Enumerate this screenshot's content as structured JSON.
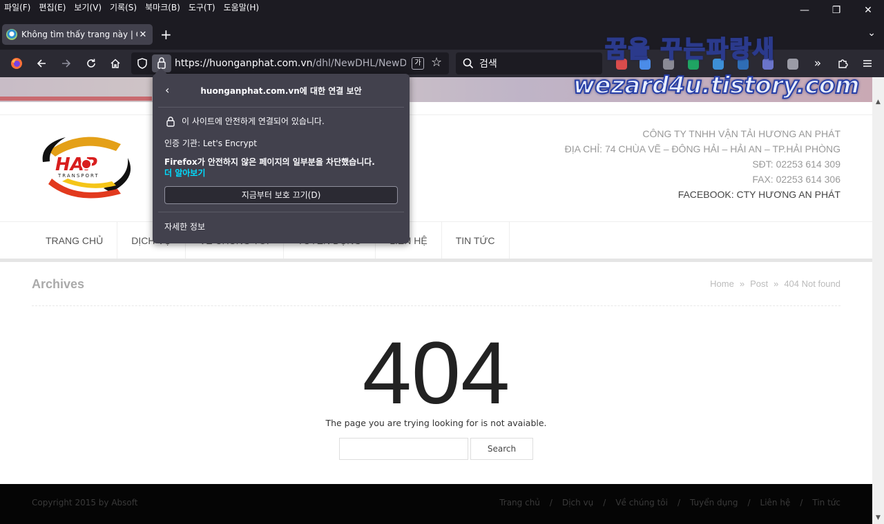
{
  "menubar": {
    "items": [
      "파일(F)",
      "편집(E)",
      "보기(V)",
      "기록(S)",
      "북마크(B)",
      "도구(T)",
      "도움말(H)"
    ]
  },
  "window_controls": {
    "minimize": "—",
    "restore": "❐",
    "close": "✕"
  },
  "tab": {
    "title": "Không tìm thấy trang này | Cô",
    "close": "✕"
  },
  "toolbar": {
    "new_tab": "+",
    "tab_list": "⌄",
    "url_host": "https://huonganphat.com.vn",
    "url_path": "/dhl/NewDHL/NewDHL/",
    "search_placeholder": "검색",
    "translate_glyph": "가",
    "star": "☆"
  },
  "watermark": {
    "line1": "꿈을 꾸는파랑새",
    "line2": "wezard4u.tistory.com"
  },
  "security_popup": {
    "title": "huonganphat.com.vn에 대한 연결 보안",
    "secure_text": "이 사이트에 안전하게 연결되어 있습니다.",
    "issuer": "인증 기관: Let's Encrypt",
    "blocked_text": "Firefox가 안전하지 않은 페이지의 일부분을 차단했습니다.",
    "learn_more": "더 알아보기",
    "disable_button": "지금부터 보호 끄기(D)",
    "more_info": "자세한 정보"
  },
  "site": {
    "company_lines": [
      "CÔNG TY TNHH VẬN TẢI HƯƠNG AN PHÁT",
      "ĐỊA CHỈ: 74 CHÙA VẼ – ĐÔNG HẢI – HẢI AN – TP.HẢI PHÒNG",
      "SĐT: 02253 614 309",
      "FAX: 02253 614 306"
    ],
    "facebook": "FACEBOOK: CTY HƯƠNG AN PHÁT",
    "logo_text": "HAP",
    "logo_sub": "TRANSPORT",
    "nav": [
      "TRANG CHỦ",
      "DỊCH VỤ",
      "VỀ CHÚNG TÔI",
      "TUYỂN DỤNG",
      "LIÊN HỆ",
      "TIN TỨC"
    ],
    "archives_title": "Archives",
    "breadcrumbs": [
      "Home",
      "Post",
      "404 Not found"
    ],
    "breadcrumb_sep": "»",
    "error_code": "404",
    "error_message": "The page you are trying looking for is not avaiable.",
    "search_button": "Search",
    "footer_copy": "Copyright 2015 by Absoft",
    "footer_links": [
      "Trang chủ",
      "Dịch vụ",
      "Về chúng tôi",
      "Tuyển dụng",
      "Liên hệ",
      "Tin tức"
    ],
    "footer_sep": "/"
  },
  "colors": {
    "chrome_dark": "#1c1b22",
    "toolbar": "#2b2a33",
    "popup_bg": "#42414d",
    "link_accent": "#00ddff",
    "footer_bg": "#050505"
  }
}
